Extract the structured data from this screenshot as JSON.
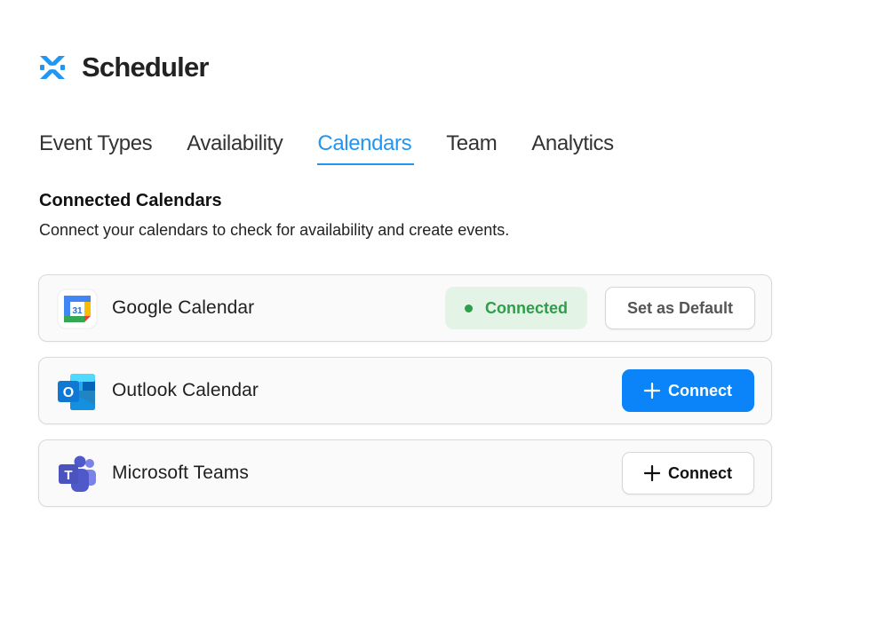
{
  "app": {
    "name": "Scheduler",
    "logo_icon": "scheduler-logo-icon",
    "accent_color": "#2196f3"
  },
  "tabs": [
    {
      "label": "Event Types",
      "active": false
    },
    {
      "label": "Availability",
      "active": false
    },
    {
      "label": "Calendars",
      "active": true
    },
    {
      "label": "Team",
      "active": false
    },
    {
      "label": "Analytics",
      "active": false
    }
  ],
  "section": {
    "title": "Connected Calendars",
    "description": "Connect your calendars to check for availability and create events."
  },
  "calendars": [
    {
      "name": "Google Calendar",
      "icon": "google-calendar-icon",
      "icon_text": "31",
      "status": "Connected",
      "status_color": "#2e9e4a",
      "action_label": "Set as Default"
    },
    {
      "name": "Outlook Calendar",
      "icon": "outlook-icon",
      "icon_text": "O",
      "action_label": "Connect",
      "action_color": "#0a84f8"
    },
    {
      "name": "Microsoft Teams",
      "icon": "microsoft-teams-icon",
      "icon_text": "T",
      "action_label": "Connect"
    }
  ]
}
